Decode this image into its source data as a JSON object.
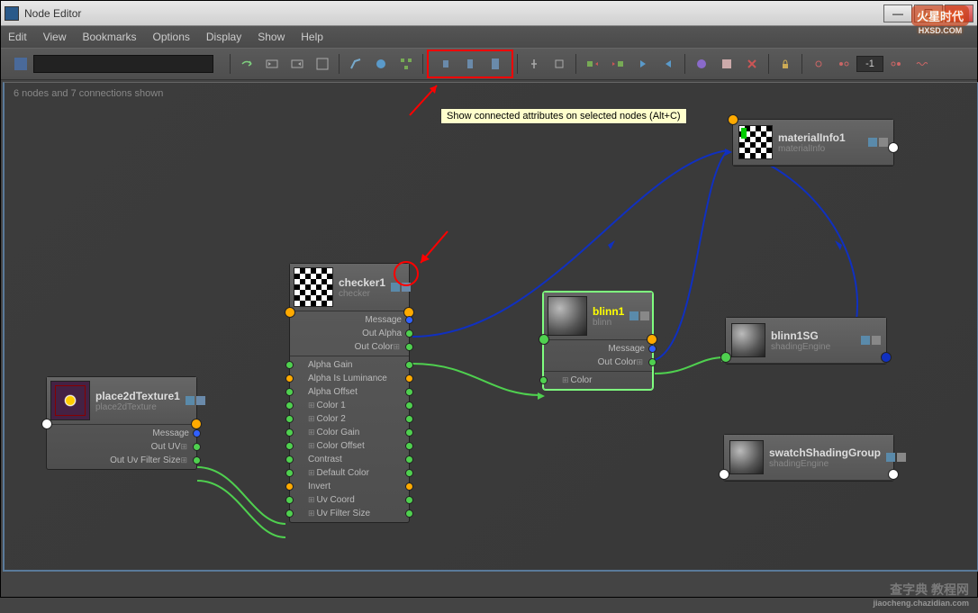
{
  "window": {
    "title": "Node Editor"
  },
  "menu": [
    "Edit",
    "View",
    "Bookmarks",
    "Options",
    "Display",
    "Show",
    "Help"
  ],
  "status": "6 nodes and 7 connections shown",
  "tooltip": "Show connected attributes on selected nodes (Alt+C)",
  "toolbar": {
    "depth": "-1"
  },
  "nodes": {
    "place2d": {
      "name": "place2dTexture1",
      "type": "place2dTexture",
      "attrs": [
        "Message",
        "Out UV",
        "Out Uv Filter Size"
      ]
    },
    "checker": {
      "name": "checker1",
      "type": "checker",
      "attrs_right": [
        "Message",
        "Out Alpha",
        "Out Color"
      ],
      "attrs_both": [
        "Alpha Gain",
        "Alpha Is Luminance",
        "Alpha Offset",
        "Color 1",
        "Color 2",
        "Color Gain",
        "Color Offset",
        "Contrast",
        "Default Color",
        "Invert",
        "Uv Coord",
        "Uv Filter Size"
      ]
    },
    "blinn": {
      "name": "blinn1",
      "type": "blinn",
      "attrs_right": [
        "Message",
        "Out Color"
      ],
      "attrs_left": [
        "Color"
      ]
    },
    "materialinfo": {
      "name": "materialInfo1",
      "type": "materialInfo"
    },
    "blinnsg": {
      "name": "blinn1SG",
      "type": "shadingEngine"
    },
    "swatch": {
      "name": "swatchShadingGroup",
      "type": "shadingEngine"
    }
  },
  "watermarks": {
    "top": "火星时代",
    "top_url": "HXSD.COM",
    "bottom": "查字典  教程网",
    "bottom_url": "jiaocheng.chazidian.com"
  }
}
